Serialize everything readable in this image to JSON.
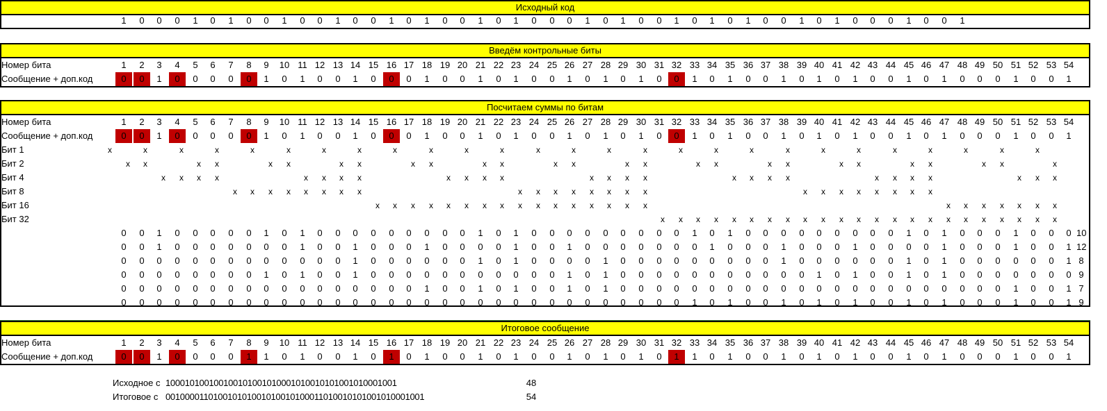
{
  "sections": {
    "source_title": "Исходный код",
    "insert_title": "Введём контрольные биты",
    "sums_title": "Посчитаем суммы по битам",
    "final_title": "Итоговое сообщение"
  },
  "labels": {
    "bit_number": "Номер бита",
    "message": "Сообщение + доп.код",
    "bit_1": "Бит 1",
    "bit_2": "Бит 2",
    "bit_4": "Бит 4",
    "bit_8": "Бит 8",
    "bit_16": "Бит 16",
    "bit_32": "Бит 32",
    "source_short": "Исходное с",
    "final_short": "Итоговое с"
  },
  "source_bits": [
    1,
    0,
    0,
    0,
    1,
    0,
    1,
    0,
    0,
    1,
    0,
    0,
    1,
    0,
    0,
    1,
    0,
    1,
    0,
    0,
    1,
    0,
    1,
    0,
    0,
    0,
    1,
    0,
    1,
    0,
    0,
    1,
    0,
    1,
    0,
    1,
    0,
    0,
    1,
    0,
    1,
    0,
    0,
    0,
    1,
    0,
    0,
    1
  ],
  "bit_numbers": [
    1,
    2,
    3,
    4,
    5,
    6,
    7,
    8,
    9,
    10,
    11,
    12,
    13,
    14,
    15,
    16,
    17,
    18,
    19,
    20,
    21,
    22,
    23,
    24,
    25,
    26,
    27,
    28,
    29,
    30,
    31,
    32,
    33,
    34,
    35,
    36,
    37,
    38,
    39,
    40,
    41,
    42,
    43,
    44,
    45,
    46,
    47,
    48,
    49,
    50,
    51,
    52,
    53,
    54
  ],
  "message_bits": [
    0,
    0,
    1,
    0,
    0,
    0,
    0,
    0,
    1,
    0,
    1,
    0,
    0,
    1,
    0,
    0,
    0,
    1,
    0,
    0,
    1,
    0,
    1,
    0,
    0,
    1,
    0,
    1,
    0,
    1,
    0,
    0,
    1,
    0,
    1,
    0,
    0,
    1,
    0,
    1,
    0,
    1,
    0,
    0,
    1,
    0,
    1,
    0,
    0,
    0,
    1,
    0,
    0,
    1
  ],
  "final_bits": [
    0,
    0,
    1,
    0,
    0,
    0,
    0,
    1,
    1,
    0,
    1,
    0,
    0,
    1,
    0,
    1,
    0,
    1,
    0,
    0,
    1,
    0,
    1,
    0,
    0,
    1,
    0,
    1,
    0,
    1,
    0,
    1,
    1,
    0,
    1,
    0,
    0,
    1,
    0,
    1,
    0,
    1,
    0,
    0,
    1,
    0,
    1,
    0,
    0,
    0,
    1,
    0,
    0,
    1
  ],
  "control_positions": [
    1,
    2,
    4,
    8,
    16,
    32
  ],
  "x_marks": {
    "bit_1": [
      0,
      2,
      4,
      6,
      8,
      10,
      12,
      14,
      16,
      18,
      20,
      22,
      24,
      26,
      28,
      30,
      32,
      34,
      36,
      38,
      40,
      42,
      44,
      46,
      48,
      50,
      52
    ],
    "bit_2": [
      1,
      2,
      5,
      6,
      9,
      10,
      13,
      14,
      17,
      18,
      21,
      22,
      25,
      26,
      29,
      30,
      33,
      34,
      37,
      38,
      41,
      42,
      45,
      46,
      49,
      50,
      53
    ],
    "bit_4": [
      3,
      4,
      5,
      6,
      11,
      12,
      13,
      14,
      19,
      20,
      21,
      22,
      27,
      28,
      29,
      30,
      35,
      36,
      37,
      38,
      43,
      44,
      45,
      46,
      51,
      52,
      53
    ],
    "bit_8": [
      7,
      8,
      9,
      10,
      11,
      12,
      13,
      14,
      23,
      24,
      25,
      26,
      27,
      28,
      29,
      30,
      39,
      40,
      41,
      42,
      43,
      44,
      45,
      46
    ],
    "bit_16": [
      15,
      16,
      17,
      18,
      19,
      20,
      21,
      22,
      23,
      24,
      25,
      26,
      27,
      28,
      29,
      30,
      47,
      48,
      49,
      50,
      51,
      52,
      53
    ],
    "bit_32": [
      31,
      32,
      33,
      34,
      35,
      36,
      37,
      38,
      39,
      40,
      41,
      42,
      43,
      44,
      45,
      46,
      47,
      48,
      49,
      50,
      51,
      52,
      53
    ]
  },
  "sum_rows": [
    {
      "bits": [
        0,
        0,
        1,
        0,
        0,
        0,
        0,
        0,
        1,
        0,
        1,
        0,
        0,
        0,
        0,
        0,
        0,
        0,
        0,
        0,
        1,
        0,
        1,
        0,
        0,
        0,
        0,
        0,
        0,
        0,
        0,
        0,
        1,
        0,
        1,
        0,
        0,
        0,
        0,
        0,
        0,
        0,
        0,
        0,
        1,
        0,
        1,
        0,
        0,
        0,
        1,
        0,
        0,
        0
      ],
      "sum": "10"
    },
    {
      "bits": [
        0,
        0,
        1,
        0,
        0,
        0,
        0,
        0,
        0,
        0,
        1,
        0,
        0,
        1,
        0,
        0,
        0,
        1,
        0,
        0,
        0,
        0,
        1,
        0,
        0,
        1,
        0,
        0,
        0,
        0,
        0,
        0,
        0,
        1,
        0,
        0,
        0,
        1,
        0,
        0,
        0,
        1,
        0,
        0,
        0,
        0,
        1,
        0,
        0,
        0,
        1,
        0,
        0,
        1
      ],
      "sum": "12"
    },
    {
      "bits": [
        0,
        0,
        0,
        0,
        0,
        0,
        0,
        0,
        0,
        0,
        0,
        0,
        0,
        1,
        0,
        0,
        0,
        0,
        0,
        0,
        1,
        0,
        1,
        0,
        0,
        0,
        0,
        1,
        0,
        0,
        0,
        0,
        0,
        0,
        0,
        0,
        0,
        1,
        0,
        0,
        0,
        0,
        0,
        0,
        1,
        0,
        1,
        0,
        0,
        0,
        0,
        0,
        0,
        1
      ],
      "sum": "8"
    },
    {
      "bits": [
        0,
        0,
        0,
        0,
        0,
        0,
        0,
        0,
        1,
        0,
        1,
        0,
        0,
        1,
        0,
        0,
        0,
        0,
        0,
        0,
        0,
        0,
        0,
        0,
        0,
        1,
        0,
        1,
        0,
        0,
        0,
        0,
        0,
        0,
        0,
        0,
        0,
        0,
        0,
        1,
        0,
        1,
        0,
        0,
        1,
        0,
        1,
        0,
        0,
        0,
        0,
        0,
        0,
        0
      ],
      "sum": "9"
    },
    {
      "bits": [
        0,
        0,
        0,
        0,
        0,
        0,
        0,
        0,
        0,
        0,
        0,
        0,
        0,
        0,
        0,
        0,
        0,
        1,
        0,
        0,
        1,
        0,
        1,
        0,
        0,
        1,
        0,
        1,
        0,
        0,
        0,
        0,
        0,
        0,
        0,
        0,
        0,
        0,
        0,
        0,
        0,
        0,
        0,
        0,
        0,
        0,
        0,
        0,
        0,
        0,
        1,
        0,
        0,
        1
      ],
      "sum": "7"
    },
    {
      "bits": [
        0,
        0,
        0,
        0,
        0,
        0,
        0,
        0,
        0,
        0,
        0,
        0,
        0,
        0,
        0,
        0,
        0,
        0,
        0,
        0,
        0,
        0,
        0,
        0,
        0,
        0,
        0,
        0,
        0,
        0,
        0,
        0,
        1,
        0,
        1,
        0,
        0,
        1,
        0,
        1,
        0,
        1,
        0,
        0,
        1,
        0,
        1,
        0,
        0,
        0,
        1,
        0,
        0,
        1
      ],
      "sum": "9"
    }
  ],
  "bottom": {
    "source_string": "100010100100100101001010001010010101001010001001",
    "source_length": "48",
    "final_string": "001000011010010101001010010100011010010101001010001001",
    "final_length": "54"
  },
  "colors": {
    "banner": "#ffff00",
    "control_bit": "#c00000"
  }
}
